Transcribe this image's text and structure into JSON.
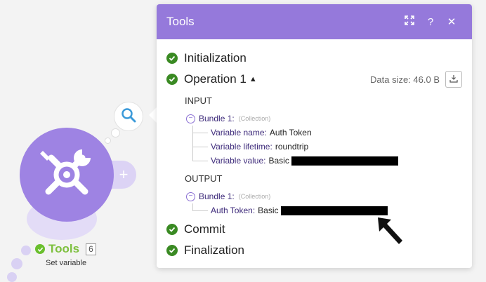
{
  "module": {
    "name": "Tools",
    "badge": "6",
    "subtitle": "Set variable"
  },
  "panel": {
    "title": "Tools",
    "operations": [
      {
        "label": "Initialization"
      },
      {
        "label": "Operation 1",
        "data_size": "Data size: 46.0 B"
      },
      {
        "label": "Commit"
      },
      {
        "label": "Finalization"
      }
    ],
    "input": {
      "title": "INPUT",
      "bundle_label": "Bundle 1:",
      "bundle_type": "(Collection)",
      "items": [
        {
          "key": "Variable name:",
          "value": "Auth Token"
        },
        {
          "key": "Variable lifetime:",
          "value": "roundtrip"
        },
        {
          "key": "Variable value:",
          "value": "Basic"
        }
      ]
    },
    "output": {
      "title": "OUTPUT",
      "bundle_label": "Bundle 1:",
      "bundle_type": "(Collection)",
      "items": [
        {
          "key": "Auth Token:",
          "value": "Basic"
        }
      ]
    }
  },
  "colors": {
    "header": "#9579db",
    "module": "#9e83e3",
    "success": "#3a8a23"
  }
}
